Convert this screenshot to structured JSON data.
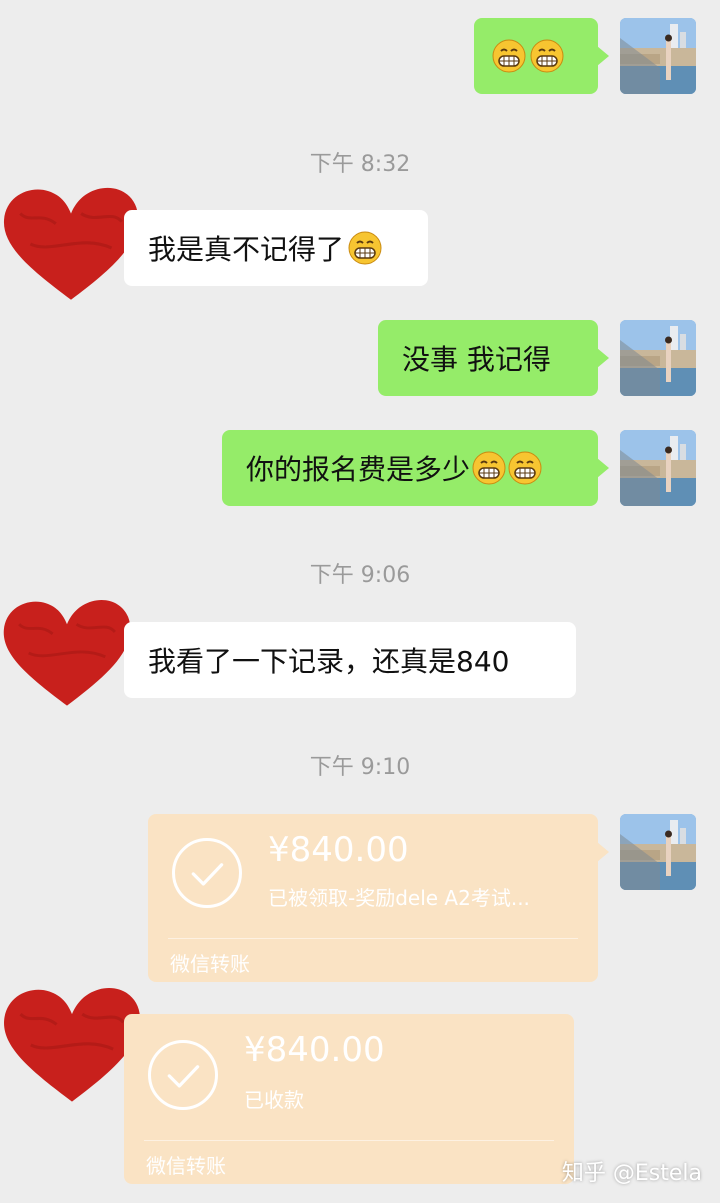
{
  "messages": {
    "m1_emojis": [
      "grin",
      "grin"
    ],
    "time1": "下午 8:32",
    "m2_text": "我是真不记得了",
    "m3_text": "没事 我记得",
    "m4_text": "你的报名费是多少",
    "time2": "下午 9:06",
    "m5_text": "我看了一下记录，还真是840",
    "time3": "下午 9:10"
  },
  "transfer_sent": {
    "amount": "¥840.00",
    "status": "已被领取-奖励dele A2考试...",
    "label": "微信转账"
  },
  "transfer_received": {
    "amount": "¥840.00",
    "status": "已收款",
    "label": "微信转账"
  },
  "watermark": "知乎 @Estela",
  "colors": {
    "background": "#ededed",
    "my_bubble": "#95ec69",
    "their_bubble": "#ffffff",
    "transfer_card": "#fae3c4",
    "heart": "#c8201c"
  },
  "icons": {
    "emoji": "grinning-face-icon",
    "check": "check-circle-icon",
    "peer_avatar": "red-heart-avatar",
    "my_avatar": "photo-avatar"
  }
}
